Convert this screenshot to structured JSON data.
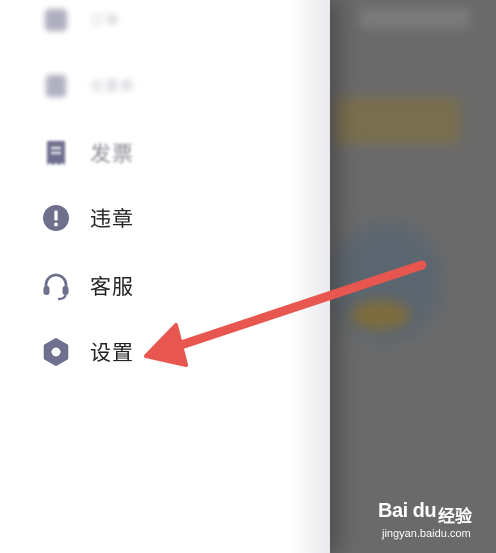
{
  "menu": {
    "items": [
      {
        "label": "订单",
        "icon": "order-icon",
        "state": "blurred"
      },
      {
        "label": "优惠券",
        "icon": "coupon-icon",
        "state": "blurred"
      },
      {
        "label": "发票",
        "icon": "invoice-icon",
        "state": "faded"
      },
      {
        "label": "违章",
        "icon": "exclamation-icon",
        "state": "normal"
      },
      {
        "label": "客服",
        "icon": "headset-icon",
        "state": "normal"
      },
      {
        "label": "设置",
        "icon": "gear-icon",
        "state": "normal"
      }
    ]
  },
  "annotation": {
    "arrow_color": "#e8574f"
  },
  "colors": {
    "icon": "#6f6f8e",
    "text": "#222222",
    "backdrop": "#6a6a6a"
  },
  "watermark": {
    "brand": "Bai du",
    "suffix": "经验",
    "url": "jingyan.baidu.com"
  }
}
